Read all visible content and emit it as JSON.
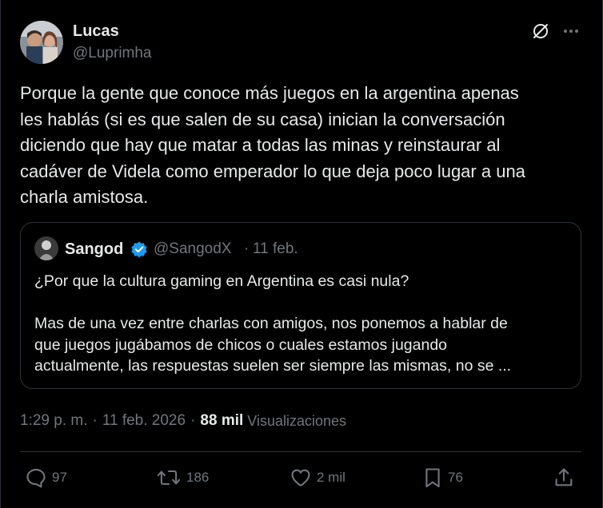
{
  "author": {
    "name": "Lucas",
    "handle": "@Luprimha"
  },
  "tweet": {
    "text": "Porque la gente que conoce más juegos en la argentina apenas\nles hablás (si es que salen de su casa) inician la conversación\ndiciendo que hay que matar a todas las minas y reinstaurar al\ncadáver de Videla como emperador lo que deja poco lugar a una\ncharla amistosa."
  },
  "quote": {
    "name": "Sangod",
    "handle": "@SangodX",
    "dot": "·",
    "date": "11 feb.",
    "text": "¿Por que la cultura gaming en Argentina es casi nula?\n\nMas de una vez entre charlas con amigos, nos ponemos a hablar de\nque juegos jugábamos de chicos o cuales estamos jugando\nactualmente, las respuestas suelen ser siempre las mismas, no se ..."
  },
  "meta": {
    "time": "1:29 p. m.",
    "dot": "·",
    "date": "11 feb. 2026",
    "views": "88 mil",
    "views_label": "Visualizaciones"
  },
  "actions": {
    "replies": "97",
    "reposts": "186",
    "likes": "2 mil",
    "bookmarks": "76"
  },
  "icons": {
    "grok": "grok-icon",
    "more": "more-icon",
    "verified": "verified-badge-icon",
    "reply": "reply-icon",
    "repost": "repost-icon",
    "like": "heart-icon",
    "bookmark": "bookmark-icon",
    "share": "share-icon"
  },
  "colors": {
    "background": "#000000",
    "text": "#e7e9ea",
    "secondary": "#71767b",
    "border": "#2f3336",
    "verified": "#1d9bf0"
  }
}
